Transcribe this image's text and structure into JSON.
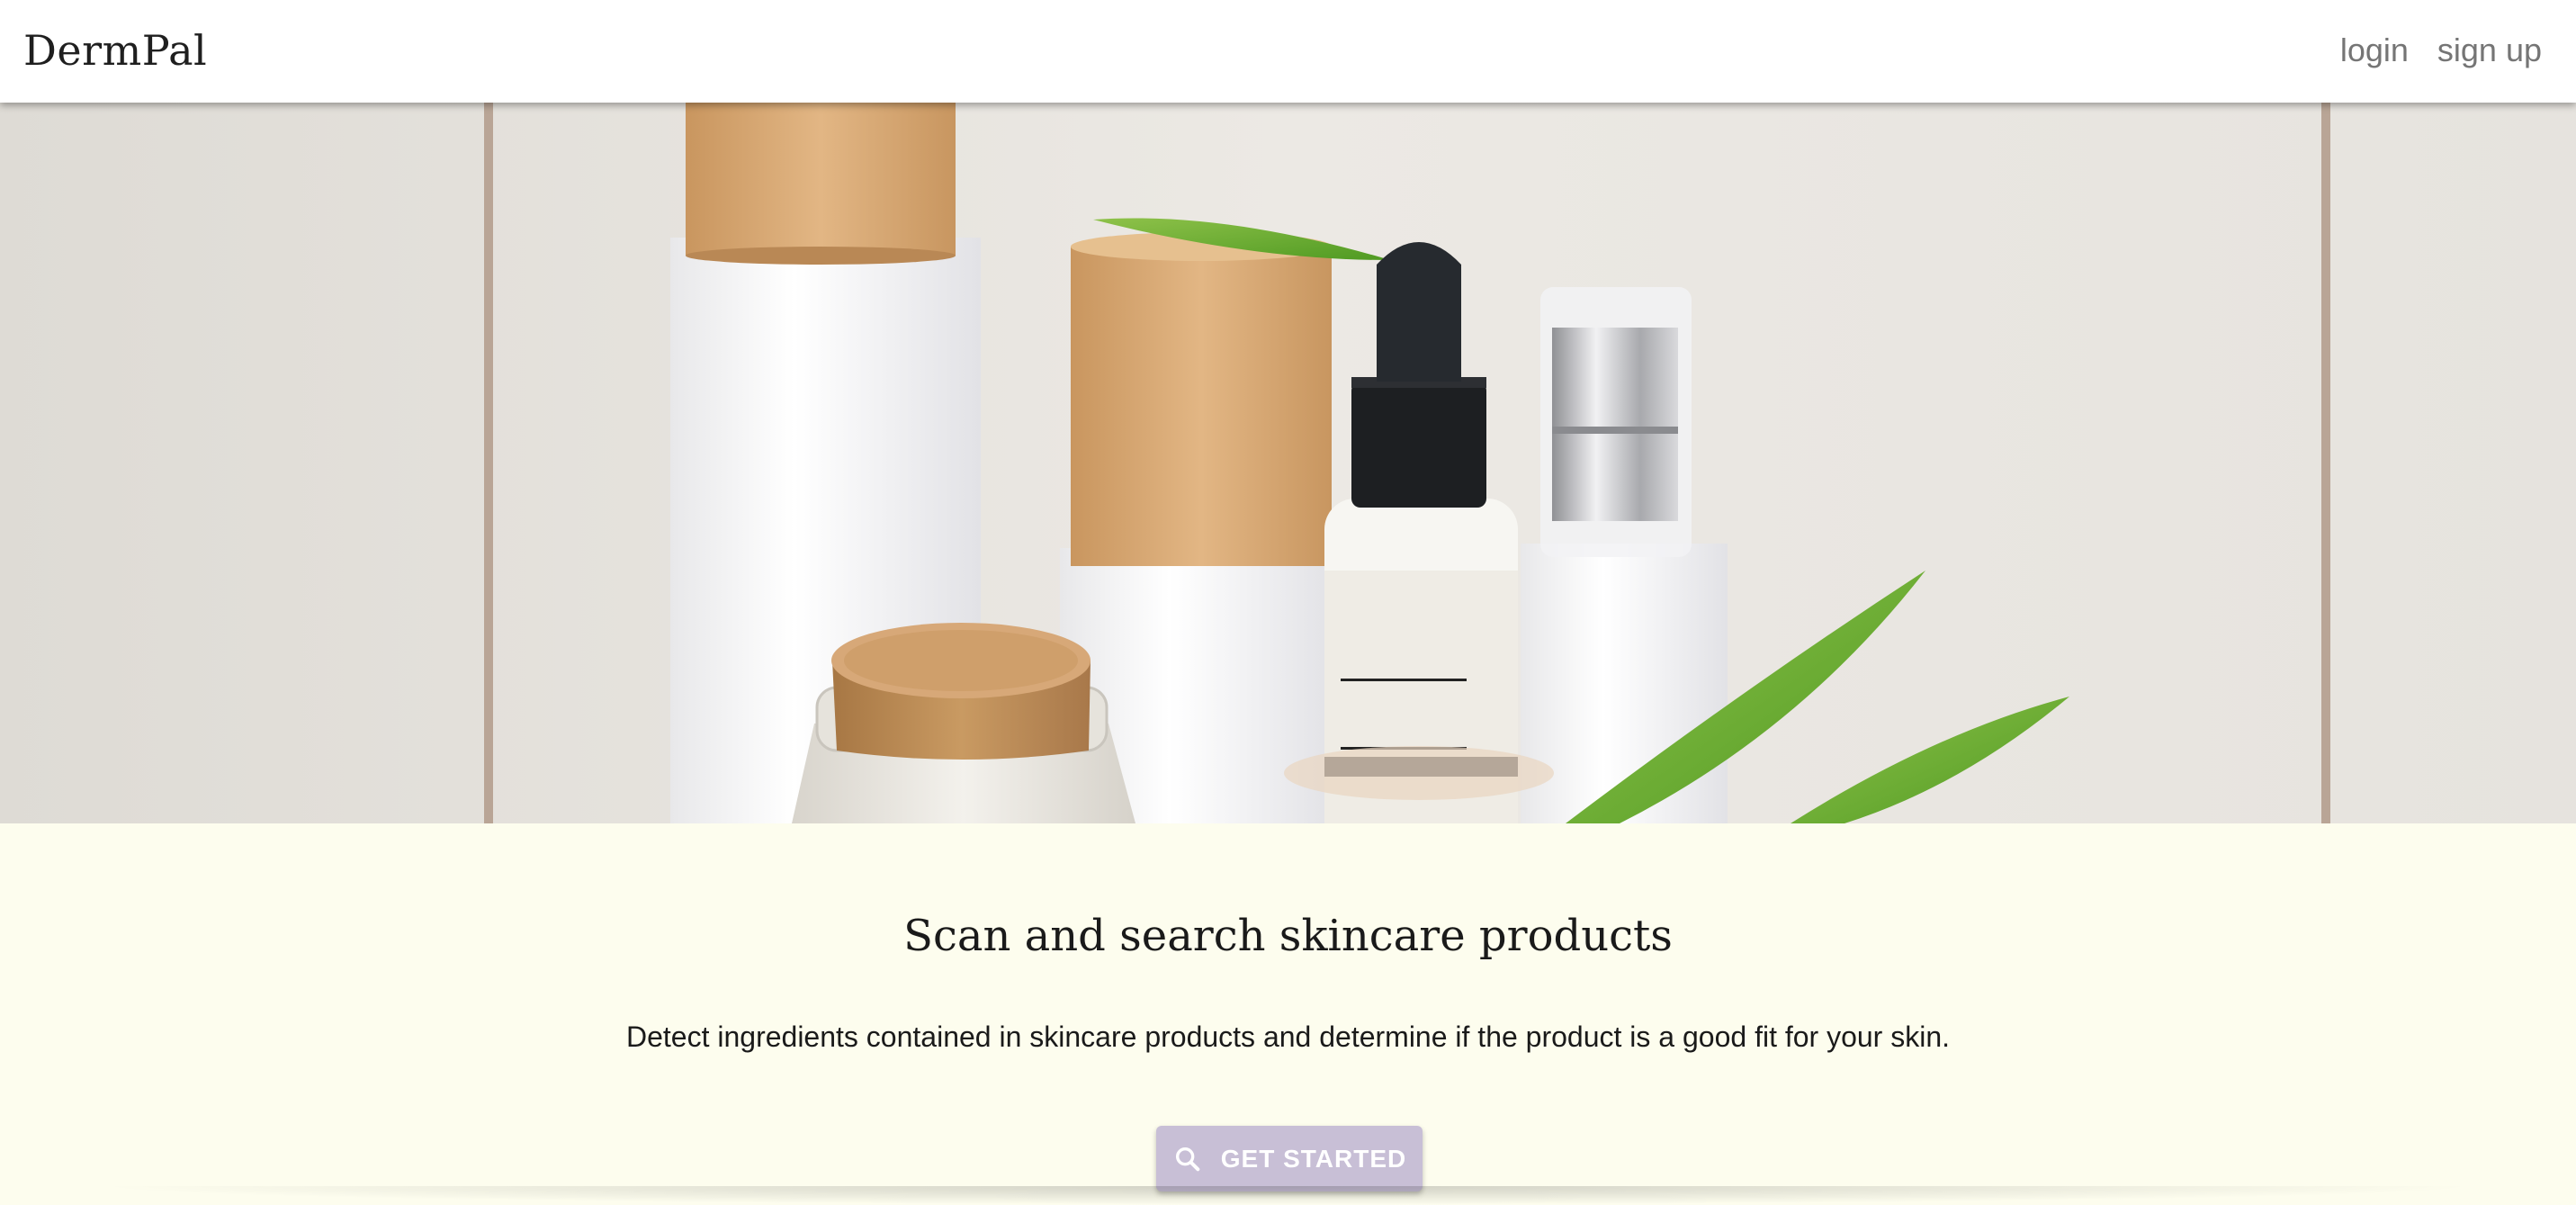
{
  "navbar": {
    "brand": "DermPal",
    "links": [
      {
        "label": "login"
      },
      {
        "label": "sign up"
      }
    ]
  },
  "hero": {
    "image": "skincare-bottles-photo"
  },
  "main": {
    "headline": "Scan and search skincare products",
    "subtext": "Detect ingredients contained in skincare products and determine if the product is a good fit for your skin.",
    "cta": {
      "label": "GET STARTED",
      "icon": "search-icon"
    }
  },
  "colors": {
    "background": "#fdfdee",
    "cta": "#c8bfd6",
    "nav_link": "#757575"
  }
}
